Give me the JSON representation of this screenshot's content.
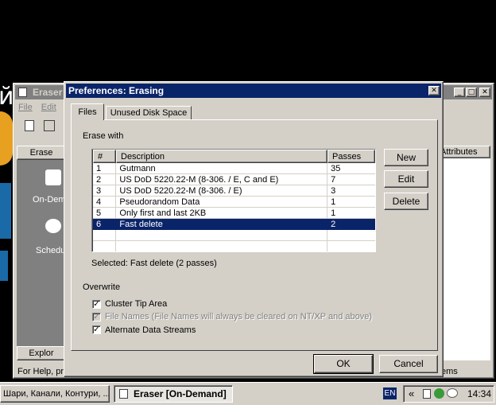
{
  "background_app": {
    "title": "Eraser",
    "menu": [
      "File",
      "Edit"
    ],
    "left_panel_header": "Erase",
    "on_demand_label": "On-Dem",
    "scheduler_label": "Schedu",
    "explorer_label": "Explor",
    "status_text": "For Help, pre",
    "right_header": "Attributes",
    "right_status": "ems",
    "left_edge_text": "й"
  },
  "dialog": {
    "title": "Preferences: Erasing",
    "close_glyph": "✕",
    "tabs": [
      {
        "label": "Files",
        "active": true
      },
      {
        "label": "Unused Disk Space",
        "active": false
      }
    ],
    "erase_with_label": "Erase with",
    "columns": [
      "#",
      "Description",
      "Passes"
    ],
    "methods": [
      {
        "num": "1",
        "desc": "Gutmann",
        "passes": "35"
      },
      {
        "num": "2",
        "desc": "US DoD 5220.22-M (8-306. / E, C and E)",
        "passes": "7"
      },
      {
        "num": "3",
        "desc": "US DoD 5220.22-M (8-306. / E)",
        "passes": "3"
      },
      {
        "num": "4",
        "desc": "Pseudorandom Data",
        "passes": "1"
      },
      {
        "num": "5",
        "desc": "Only first and last 2KB",
        "passes": "1"
      },
      {
        "num": "6",
        "desc": "Fast delete",
        "passes": "2"
      }
    ],
    "selected_index": 5,
    "side_buttons": {
      "new": "New",
      "edit": "Edit",
      "delete": "Delete"
    },
    "selected_text": "Selected: Fast delete (2 passes)",
    "overwrite_label": "Overwrite",
    "options": [
      {
        "label": "Cluster Tip Area",
        "checked": true,
        "disabled": false
      },
      {
        "label": "File Names (File Names will always be cleared on NT/XP and above)",
        "checked": true,
        "disabled": true
      },
      {
        "label": "Alternate Data Streams",
        "checked": true,
        "disabled": false
      }
    ],
    "ok_label": "OK",
    "cancel_label": "Cancel"
  },
  "taskbar": {
    "item1": "Шари, Канали, Контури, ...",
    "item2": "Eraser  [On-Demand]",
    "lang": "EN",
    "chevron": "«",
    "clock": "14:34"
  },
  "colors": {
    "title_active": "#0a246a",
    "title_inactive": "#808080",
    "face": "#d4d0c8",
    "selection": "#0a246a"
  }
}
